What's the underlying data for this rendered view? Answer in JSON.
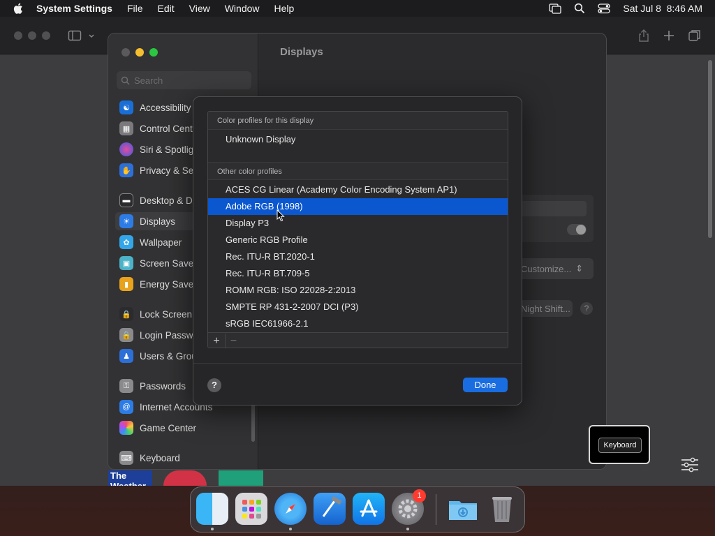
{
  "menubar": {
    "app_name": "System Settings",
    "items": [
      "File",
      "Edit",
      "View",
      "Window",
      "Help"
    ],
    "clock": "Sat Jul 8  8:46 AM"
  },
  "settings": {
    "pane_title": "Displays",
    "search_placeholder": "Search",
    "sidebar": [
      {
        "label": "Accessibility",
        "icon": "accessibility-icon",
        "color": "#1a6fd6"
      },
      {
        "label": "Control Center",
        "icon": "control-center-icon",
        "color": "#7a7a7c"
      },
      {
        "label": "Siri & Spotlight",
        "icon": "siri-icon",
        "color": "#b03aa8"
      },
      {
        "label": "Privacy & Security",
        "icon": "hand-icon",
        "color": "#2d6fd8"
      },
      {
        "label": "Desktop & Dock",
        "icon": "desktop-icon",
        "color": "#2b2b2d"
      },
      {
        "label": "Displays",
        "icon": "displays-icon",
        "color": "#2d7ce6"
      },
      {
        "label": "Wallpaper",
        "icon": "wallpaper-icon",
        "color": "#32a6e8"
      },
      {
        "label": "Screen Saver",
        "icon": "screen-saver-icon",
        "color": "#4bb2c8"
      },
      {
        "label": "Energy Saver",
        "icon": "battery-icon",
        "color": "#e8a21c"
      },
      {
        "label": "Lock Screen",
        "icon": "lock-icon",
        "color": "#2b2b2d"
      },
      {
        "label": "Login Password",
        "icon": "login-password-icon",
        "color": "#8a8a8c"
      },
      {
        "label": "Users & Groups",
        "icon": "users-icon",
        "color": "#2d6fd8"
      },
      {
        "label": "Passwords",
        "icon": "key-icon",
        "color": "#8a8a8c"
      },
      {
        "label": "Internet Accounts",
        "icon": "at-icon",
        "color": "#2d7ce6"
      },
      {
        "label": "Game Center",
        "icon": "game-center-icon",
        "color": "#d5d5d5"
      },
      {
        "label": "Keyboard",
        "icon": "keyboard-icon",
        "color": "#8a8a8c"
      }
    ],
    "pane_buttons": {
      "customize": "Customize...",
      "night_shift": "Night Shift...",
      "help": "?"
    }
  },
  "sheet": {
    "section_this_display": "Color profiles for this display",
    "this_display_profiles": [
      "Unknown Display"
    ],
    "section_other": "Other color profiles",
    "other_profiles": [
      "ACES CG Linear (Academy Color Encoding System AP1)",
      "Adobe RGB (1998)",
      "Display P3",
      "Generic RGB Profile",
      "Rec. ITU-R BT.2020-1",
      "Rec. ITU-R BT.709-5",
      "ROMM RGB: ISO 22028-2:2013",
      "SMPTE RP 431-2-2007 DCI (P3)",
      "sRGB IEC61966-2.1"
    ],
    "selected_profile": "Adobe RGB (1998)",
    "add_label": "+",
    "remove_label": "−",
    "help_label": "?",
    "done_label": "Done"
  },
  "overlay": {
    "keyboard_label": "Keyboard"
  },
  "dock": {
    "apps": [
      "finder-icon",
      "launchpad-icon",
      "safari-icon",
      "xcode-icon",
      "app-store-icon",
      "system-settings-icon",
      "downloads-folder-icon",
      "trash-icon"
    ],
    "settings_badge": "1"
  },
  "browser_thumbs": {
    "weather_label": "The Weather"
  },
  "colors": {
    "accent": "#0a57d0",
    "done_button": "#1a6de0",
    "badge": "#ff3b30"
  }
}
